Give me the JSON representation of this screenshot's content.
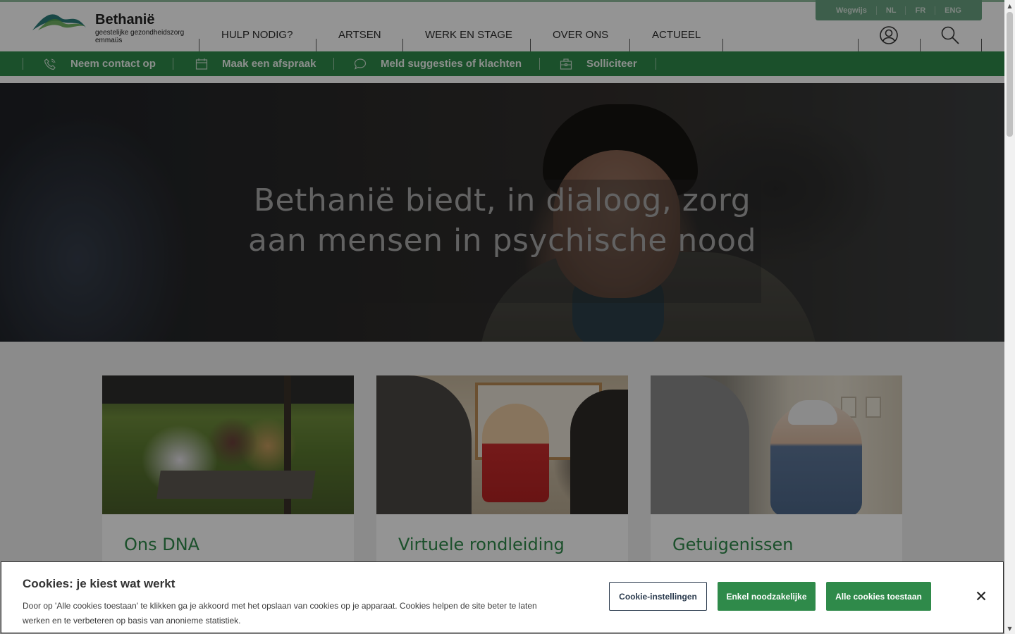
{
  "logo": {
    "name": "Bethanië",
    "subtitle_line1": "geestelijke gezondheidszorg",
    "subtitle_line2": "emmaüs"
  },
  "langbar": {
    "items": [
      "Wegwijs",
      "NL",
      "FR",
      "ENG"
    ]
  },
  "nav": {
    "items": [
      "HULP NODIG?",
      "ARTSEN",
      "WERK EN STAGE",
      "OVER ONS",
      "ACTUEEL"
    ]
  },
  "header_icons": [
    "user-icon",
    "search-icon"
  ],
  "quickbar": {
    "items": [
      {
        "label": "Neem contact op",
        "icon": "phone-icon"
      },
      {
        "label": "Maak een afspraak",
        "icon": "calendar-icon"
      },
      {
        "label": "Meld suggesties of klachten",
        "icon": "chat-bubble-icon"
      },
      {
        "label": "Solliciteer",
        "icon": "briefcase-icon"
      }
    ]
  },
  "hero": {
    "title": "Bethanië biedt, in dialoog, zorg aan mensen in psychische nood"
  },
  "cards": [
    {
      "title": "Ons DNA"
    },
    {
      "title": "Virtuele rondleiding"
    },
    {
      "title": "Getuigenissen"
    }
  ],
  "cookie": {
    "title": "Cookies: je kiest wat werkt",
    "text": "Door op 'Alle cookies toestaan' te klikken ga je akkoord met het opslaan van cookies op je apparaat. Cookies helpen de site beter te laten werken en te verbeteren op basis van anonieme statistiek.",
    "settings_label": "Cookie-instellingen",
    "necessary_label": "Enkel noodzakelijke",
    "all_label": "Alle cookies toestaan",
    "close_icon": "close-icon"
  },
  "colors": {
    "brand_green": "#2f8a4a",
    "langbar_green": "#6aa282",
    "card_title_green": "#2f8a4a"
  }
}
